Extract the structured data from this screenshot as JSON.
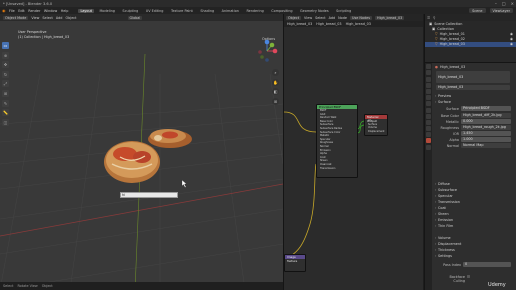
{
  "window": {
    "title": "* [Unsaved] - Blender 3.6.0",
    "controls": [
      "–",
      "□",
      "×"
    ]
  },
  "menubar": {
    "menus": [
      "File",
      "Edit",
      "Render",
      "Window",
      "Help"
    ],
    "workspaces": [
      "Layout",
      "Modeling",
      "Sculpting",
      "UV Editing",
      "Texture Paint",
      "Shading",
      "Animation",
      "Rendering",
      "Compositing",
      "Geometry Nodes",
      "Scripting"
    ],
    "active_workspace": "Layout",
    "scene_label": "Scene",
    "view_layer_label": "ViewLayer"
  },
  "viewport": {
    "header_items": [
      "Object Mode",
      "View",
      "Select",
      "Add",
      "Object"
    ],
    "global_label": "Global",
    "info_line1": "User Perspective",
    "info_line2": "(1) Collection | High_bread_03",
    "options_label": "Options",
    "text_field_value": "hi",
    "status_items": [
      "Select",
      "Rotate View",
      "Object"
    ],
    "tools": [
      "select",
      "cursor",
      "move",
      "rotate",
      "scale",
      "transform",
      "annotate",
      "measure",
      "add-cube"
    ]
  },
  "node_editor": {
    "header_items": [
      "Object",
      "View",
      "Select",
      "Add",
      "Node",
      "Use Nodes"
    ],
    "material_name": "High_bread_03",
    "breadcrumbs": [
      "High_bread_03",
      "High_bread_03",
      "High_bread_03"
    ],
    "bsdf_node": {
      "title": "Principled BSDF",
      "rows": [
        "BSDF",
        "GGX",
        "Random Walk",
        "Base Color",
        "Subsurface",
        "Subsurface Radius",
        "Subsurface Color",
        "Metallic",
        "Specular",
        "Roughness",
        "Normal",
        "Emission",
        "Alpha",
        "Coat",
        "Sheen",
        "Clearcoat",
        "Transmission"
      ]
    },
    "output_node": {
      "title": "Material Output",
      "rows": [
        "All",
        "Surface",
        "Volume",
        "Displacement"
      ]
    },
    "small_node": {
      "title": "Image Texture"
    }
  },
  "outliner": {
    "header_label": "Scene Collection",
    "rows": [
      {
        "label": "Scene Collection",
        "selected": false
      },
      {
        "label": "Collection",
        "selected": false
      },
      {
        "label": "High_bread_01",
        "selected": false
      },
      {
        "label": "High_bread_02",
        "selected": false
      },
      {
        "label": "High_bread_03",
        "selected": true
      }
    ]
  },
  "properties": {
    "object_name": "High_bread_03",
    "material_slot": "High_bread_03",
    "sections_top": [
      "Preview",
      "Surface"
    ],
    "surface_shader": "Principled BSDF",
    "base_color_value": "High_bread_diff_2k.jpg",
    "metallic_value": "0.000",
    "roughness_image": "High_bread_rough_2k.jpg",
    "ior_value": "1.450",
    "alpha_value": "1.000",
    "normal_label": "Normal Map",
    "sections_mid": [
      "Diffuse",
      "Subsurface",
      "Specular",
      "Transmission",
      "Coat",
      "Sheen",
      "Emission",
      "Thin Film"
    ],
    "sections_bottom": [
      "Volume",
      "Displacement",
      "Thickness",
      "Settings"
    ],
    "pass_index_label": "Pass Index",
    "pass_index_value": "0",
    "backface_label": "Backface Culling"
  },
  "watermark": "Udemy"
}
